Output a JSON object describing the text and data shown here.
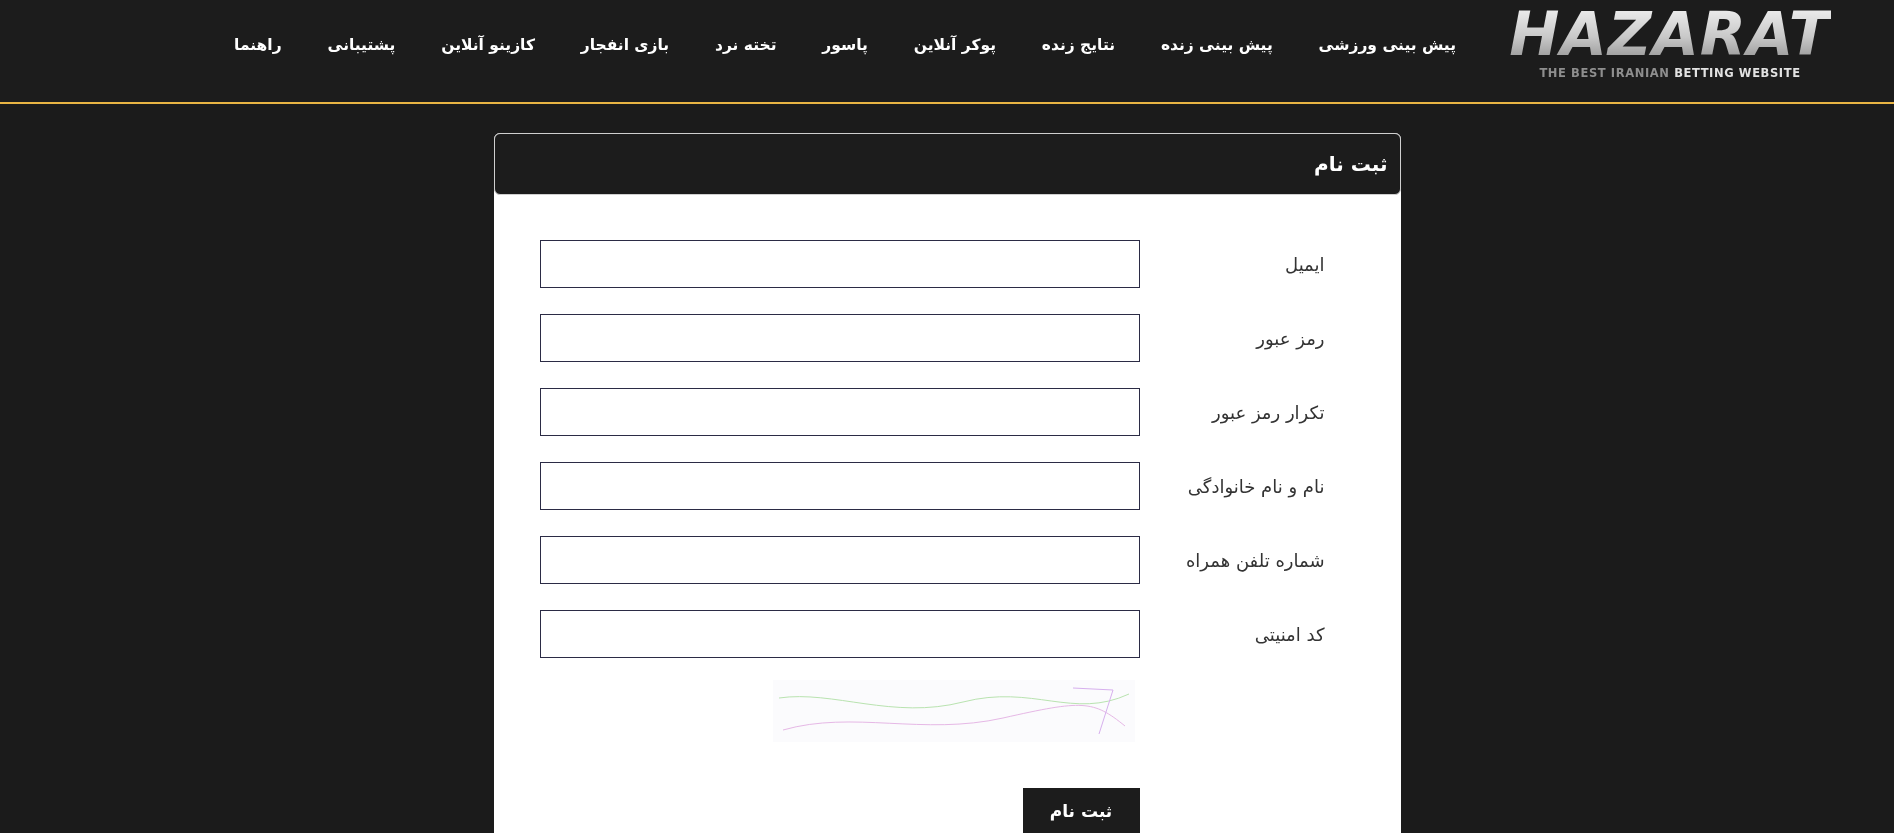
{
  "header": {
    "logo": {
      "wordmark": "HAZARAT",
      "tagline": "THE BEST IRANIAN **BETTING WEBSITE**"
    },
    "nav": [
      "پیش بینی ورزشی",
      "پیش بینی زنده",
      "نتایج زنده",
      "پوکر آنلاین",
      "پاسور",
      "تخته نرد",
      "بازی انفجار",
      "کازینو آنلاین",
      "پشتیبانی",
      "راهنما"
    ]
  },
  "form": {
    "title": "ثبت نام",
    "fields": [
      {
        "label": "ایمیل"
      },
      {
        "label": "رمز عبور"
      },
      {
        "label": "تکرار رمز عبور"
      },
      {
        "label": "نام و نام خانوادگی"
      },
      {
        "label": "شماره تلفن همراه"
      },
      {
        "label": "کد امنیتی"
      }
    ],
    "submit": "ثبت نام"
  }
}
